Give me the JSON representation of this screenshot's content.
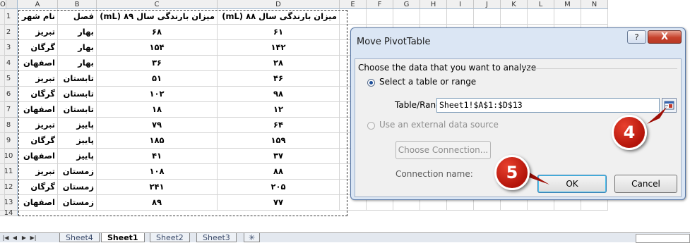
{
  "sheet": {
    "columns": [
      "A",
      "B",
      "C",
      "D",
      "E",
      "F",
      "G",
      "H",
      "I",
      "J",
      "K",
      "L",
      "M",
      "N",
      "O"
    ],
    "rows": [
      "1",
      "2",
      "3",
      "4",
      "5",
      "6",
      "7",
      "8",
      "9",
      "10",
      "11",
      "12",
      "13",
      "14"
    ],
    "header": [
      "نام شهر",
      "فصل",
      "میزان بارندگی سال ۸۹ (mL)",
      "میزان بارندگی سال ۸۸ (mL)"
    ],
    "data": [
      [
        "تبریز",
        "بهار",
        "۶۸",
        "۶۱"
      ],
      [
        "گرگان",
        "بهار",
        "۱۵۴",
        "۱۴۲"
      ],
      [
        "اصفهان",
        "بهار",
        "۳۶",
        "۲۸"
      ],
      [
        "تبریز",
        "تابستان",
        "۵۱",
        "۴۶"
      ],
      [
        "گرگان",
        "تابستان",
        "۱۰۲",
        "۹۸"
      ],
      [
        "اصفهان",
        "تابستان",
        "۱۸",
        "۱۲"
      ],
      [
        "تبریز",
        "پاییز",
        "۷۹",
        "۶۴"
      ],
      [
        "گرگان",
        "پاییز",
        "۱۸۵",
        "۱۵۹"
      ],
      [
        "اصفهان",
        "پاییز",
        "۴۱",
        "۳۷"
      ],
      [
        "تبریز",
        "زمستان",
        "۱۰۸",
        "۸۸"
      ],
      [
        "گرگان",
        "زمستان",
        "۲۴۱",
        "۲۰۵"
      ],
      [
        "اصفهان",
        "زمستان",
        "۸۹",
        "۷۷"
      ]
    ]
  },
  "tabs": {
    "sheets": [
      "Sheet4",
      "Sheet1",
      "Sheet2",
      "Sheet3"
    ],
    "active": "Sheet1"
  },
  "dialog": {
    "title": "Move PivotTable",
    "help_label": "?",
    "close_label": "X",
    "section_label": "Choose the data that you want to analyze",
    "option_table": "Select a table or range",
    "table_range_label": "Table/Range:",
    "table_range_value": "Sheet1!$A$1:$D$13",
    "option_external": "Use an external data source",
    "choose_connection": "Choose Connection...",
    "connection_name_label": "Connection name:",
    "ok_label": "OK",
    "cancel_label": "Cancel"
  },
  "callouts": {
    "step4": "4",
    "step5": "5"
  },
  "colors": {
    "callout": "#c8180c",
    "close_button": "#c6412c",
    "dialog_frame": "#dbe6f4"
  }
}
